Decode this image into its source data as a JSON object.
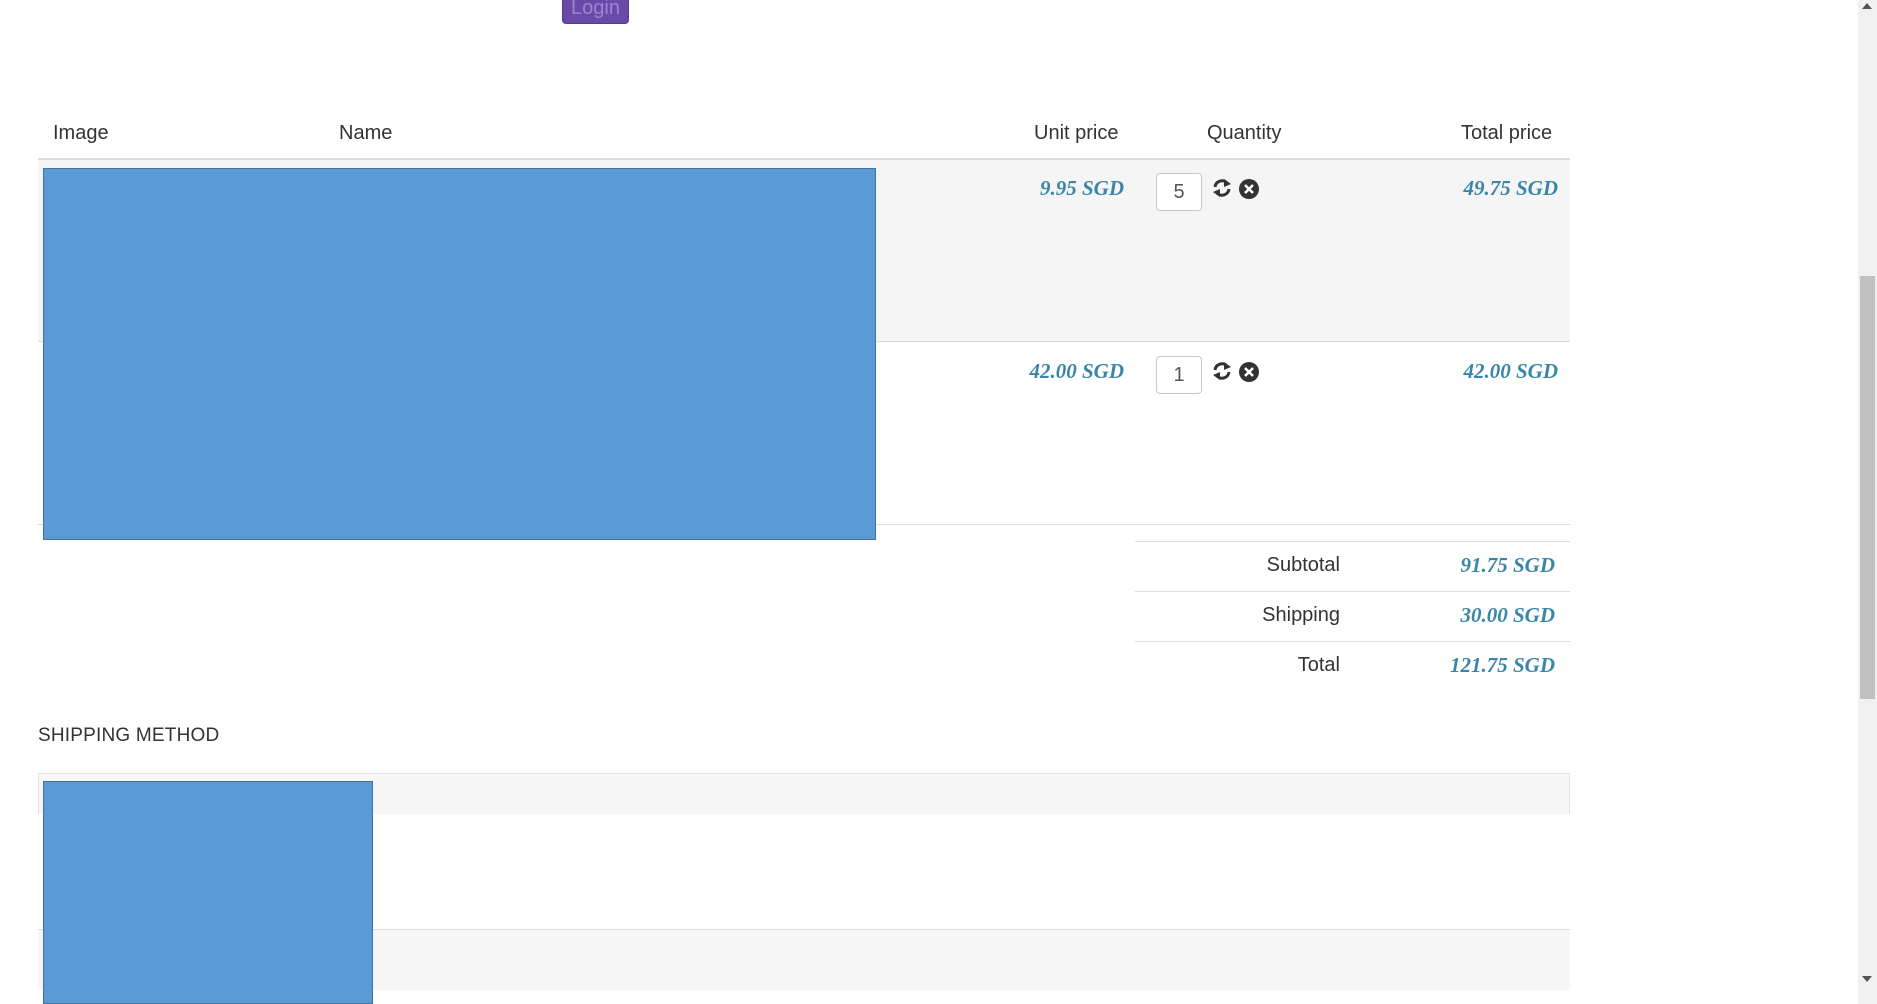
{
  "header": {
    "login_label": "Login"
  },
  "cart": {
    "columns": {
      "image": "Image",
      "name": "Name",
      "unit_price": "Unit price",
      "quantity": "Quantity",
      "total_price": "Total price"
    },
    "items": [
      {
        "unit_price": "9.95 SGD",
        "quantity": "5",
        "total_price": "49.75 SGD"
      },
      {
        "unit_price": "42.00 SGD",
        "quantity": "1",
        "total_price": "42.00 SGD"
      }
    ],
    "summary": {
      "subtotal_label": "Subtotal",
      "subtotal_value": "91.75 SGD",
      "shipping_label": "Shipping",
      "shipping_value": "30.00 SGD",
      "total_label": "Total",
      "total_value": "121.75 SGD"
    }
  },
  "shipping": {
    "title": "SHIPPING METHOD"
  },
  "icons": {
    "update": "refresh-icon",
    "remove": "remove-circle-icon"
  },
  "colors": {
    "price": "#3a86a8",
    "login_button": "#6a4aa8",
    "image_placeholder": "#5b9bd5",
    "row_stripe": "#f5f5f5"
  }
}
